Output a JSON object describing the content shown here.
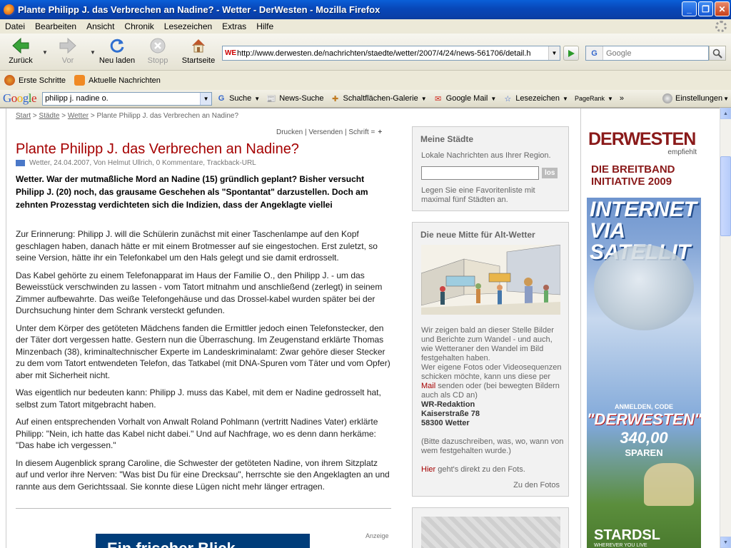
{
  "window": {
    "title": "Plante Philipp J. das Verbrechen an Nadine? - Wetter - DerWesten - Mozilla Firefox"
  },
  "menu": [
    "Datei",
    "Bearbeiten",
    "Ansicht",
    "Chronik",
    "Lesezeichen",
    "Extras",
    "Hilfe"
  ],
  "nav": {
    "back": "Zurück",
    "forward": "Vor",
    "reload": "Neu laden",
    "stop": "Stopp",
    "home": "Startseite",
    "url": "http://www.derwesten.de/nachrichten/staedte/wetter/2007/4/24/news-561706/detail.h",
    "site_icon": "WE",
    "search_placeholder": "Google",
    "search_engine_letter": "G"
  },
  "bookmarks": [
    "Erste Schritte",
    "Aktuelle Nachrichten"
  ],
  "google_toolbar": {
    "logo": "Google",
    "query": "philipp j. nadine o.",
    "buttons": [
      "Suche",
      "News-Suche",
      "Schaltflächen-Galerie",
      "Google Mail",
      "Lesezeichen",
      "PageRank",
      "»",
      "Einstellungen"
    ]
  },
  "article": {
    "breadcrumb": [
      "Start",
      "Städte",
      "Wetter",
      "Plante Philipp J. das Verbrechen an Nadine?"
    ],
    "tools": "Drucken | Versenden | Schrift",
    "headline": "Plante Philipp J. das Verbrechen an Nadine?",
    "meta": "Wetter, 24.04.2007, Von Helmut Ullrich,  0 Kommentare, Trackback-URL",
    "teaser": "Wetter. War der mutmaßliche Mord an Nadine (15) gründlich geplant? Bisher versucht Philipp J. (20) noch, das grausame Geschehen als \"Spontantat\" darzustellen. Doch am zehnten Prozesstag verdichteten sich die Indizien, dass der Angeklagte viellei",
    "paragraphs": [
      "Zur Erinnerung: Philipp J. will die Schülerin zunächst mit einer Taschenlampe auf den Kopf geschlagen haben, danach hätte er mit einem Brotmesser auf sie eingestochen. Erst zuletzt, so seine Version, hätte ihr ein Telefonkabel um den Hals gelegt und sie damit erdrosselt.",
      "Das Kabel gehörte zu einem Telefonapparat im Haus der Familie O., den Philipp J. - um das Beweisstück verschwinden zu lassen - vom Tatort mitnahm und anschließend (zerlegt) in seinem Zimmer aufbewahrte. Das weiße Telefongehäuse und das Drossel-kabel wurden später bei der Durchsuchung hinter dem Schrank versteckt gefunden.",
      "Unter dem Körper des getöteten Mädchens fanden die Ermittler jedoch einen Telefonstecker, den der Täter dort vergessen hatte. Gestern nun die Überraschung. Im Zeugenstand erklärte Thomas Minzenbach (38), kriminaltechnischer Experte im Landeskriminalamt: Zwar gehöre dieser Stecker zu dem vom Tatort entwendeten Telefon, das Tatkabel (mit DNA-Spuren vom Täter und vom Opfer) aber mit Sicherheit nicht.",
      "Was eigentlich nur bedeuten kann: Philipp J. muss das Kabel, mit dem er Nadine gedrosselt hat, selbst zum Tatort mitgebracht haben.",
      "Auf einen entsprechenden Vorhalt von Anwalt Roland Pohlmann (vertritt Nadines Vater) erklärte Philipp: \"Nein, ich hatte das Kabel nicht dabei.\" Und auf Nachfrage, wo es denn dann herkäme: \"Das habe ich vergessen.\"",
      "In diesem Augenblick sprang Caroline, die Schwester der getöteten Nadine, von ihrem Sitzplatz auf und verlor ihre Nerven: \"Was bist Du für eine Drecksau\", herrschte sie den Angeklagten an und rannte aus dem Gerichtssaal. Sie konnte diese Lügen nicht mehr länger ertragen."
    ],
    "anzeige_label": "Anzeige",
    "anzeige_text": "Ein frischer Blick"
  },
  "sidebar": {
    "staedte": {
      "title": "Meine Städte",
      "subtitle": "Lokale Nachrichten aus Ihrer Region.",
      "button": "los",
      "hint": "Legen Sie eine Favoritenliste mit maximal fünf Städten an."
    },
    "mitte": {
      "title": "Die neue Mitte für Alt-Wetter",
      "text1": "Wir zeigen bald an dieser Stelle Bilder und Berichte zum Wandel - und auch, wie Wetteraner den Wandel im Bild festgehalten haben.",
      "text2a": "Wer eigene Fotos oder Videosequenzen schicken möchte, kann uns diese per",
      "mail": "Mail",
      "text2b": "senden   oder (bei bewegten Bildern auch als CD an)",
      "addr1": "WR-Redaktion",
      "addr2": "Kaiserstraße 78",
      "addr3": "58300 Wetter",
      "note": "(Bitte dazuschreiben, was, wo, wann von wem festgehalten wurde.)",
      "hier": "Hier",
      "hier_rest": " geht's direkt zu den Fots.",
      "link": "Zu den Fotos"
    }
  },
  "banner": {
    "brand": "DERWESTEN",
    "brand_sub": "empfiehlt",
    "headline": "DIE BREITBAND INITIATIVE 2009",
    "main": "INTERNET VIA SATELLIT",
    "code_line": "ANMELDEN, CODE",
    "code": "\"DERWESTEN\"",
    "price": "340,00",
    "save": "SPAREN",
    "sponsor": "STARDSL",
    "sponsor_tag": "WHEREVER YOU LIVE"
  }
}
